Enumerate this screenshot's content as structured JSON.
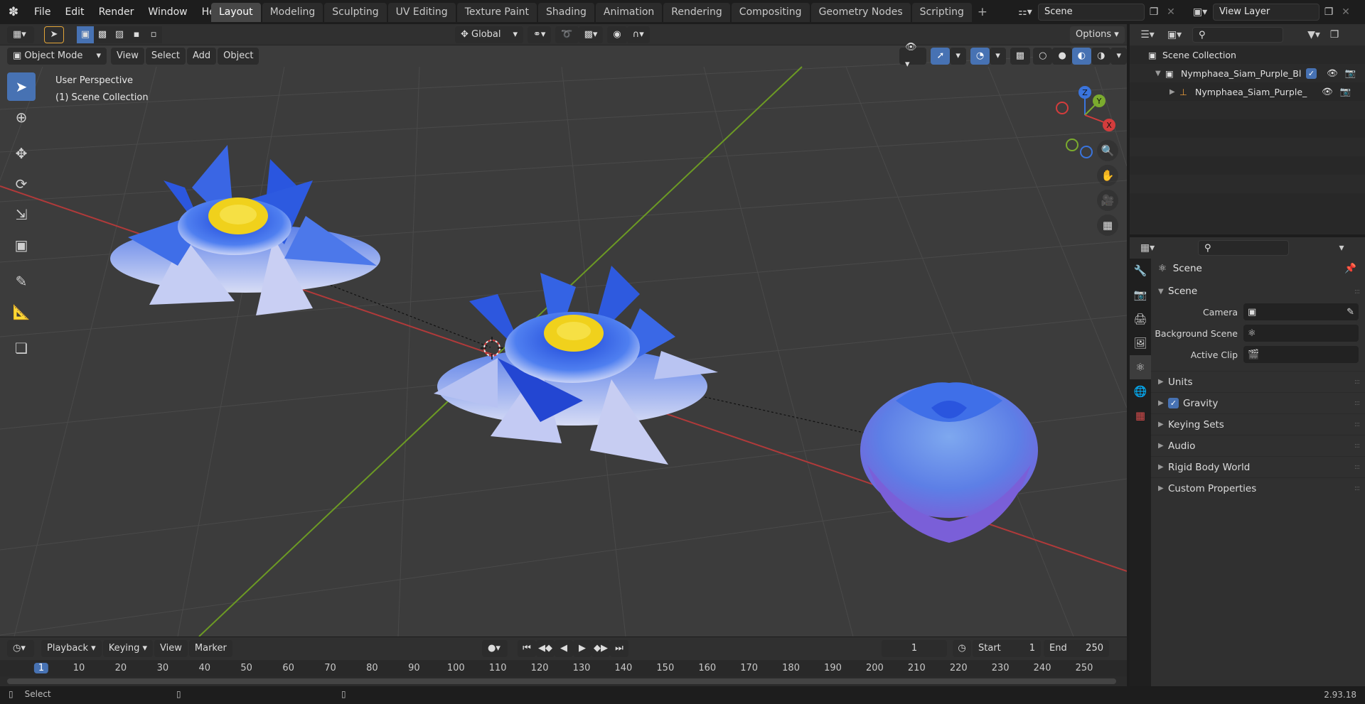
{
  "topbar": {
    "menus": [
      "File",
      "Edit",
      "Render",
      "Window",
      "Help"
    ],
    "workspaces": [
      "Layout",
      "Modeling",
      "Sculpting",
      "UV Editing",
      "Texture Paint",
      "Shading",
      "Animation",
      "Rendering",
      "Compositing",
      "Geometry Nodes",
      "Scripting"
    ],
    "active_workspace": "Layout",
    "plus": "+",
    "scene": "Scene",
    "view_layer": "View Layer"
  },
  "viewport": {
    "mode": "Object Mode",
    "menus": [
      "View",
      "Select",
      "Add",
      "Object"
    ],
    "transform_orientation": "Global",
    "options_label": "Options",
    "overlay_line1": "User Perspective",
    "overlay_line2": "(1) Scene Collection",
    "gizmo": {
      "z": "Z",
      "y": "Y",
      "x": "X"
    }
  },
  "timeline": {
    "menus": [
      "Playback",
      "Keying",
      "View",
      "Marker"
    ],
    "current_frame": "1",
    "start_label": "Start",
    "start_value": "1",
    "end_label": "End",
    "end_value": "250",
    "ruler": [
      "1",
      "10",
      "20",
      "30",
      "40",
      "50",
      "60",
      "70",
      "80",
      "90",
      "100",
      "110",
      "120",
      "130",
      "140",
      "150",
      "160",
      "170",
      "180",
      "190",
      "200",
      "210",
      "220",
      "230",
      "240",
      "250"
    ]
  },
  "statusbar": {
    "select_label": "Select",
    "version": "2.93.18"
  },
  "outliner": {
    "root": "Scene Collection",
    "collection": "Nymphaea_Siam_Purple_Blue",
    "object": "Nymphaea_Siam_Purple_"
  },
  "properties": {
    "context": "Scene",
    "panel_title": "Scene",
    "camera_label": "Camera",
    "background_label": "Background Scene",
    "active_clip_label": "Active Clip",
    "subpanels": [
      "Units",
      "Gravity",
      "Keying Sets",
      "Audio",
      "Rigid Body World",
      "Custom Properties"
    ]
  },
  "colors": {
    "accent": "#4772b3",
    "x_axis": "#c23a3a",
    "y_axis": "#7bab2e",
    "petal_blue": "#2f5fdc",
    "stamen_yellow": "#f2d21a"
  }
}
